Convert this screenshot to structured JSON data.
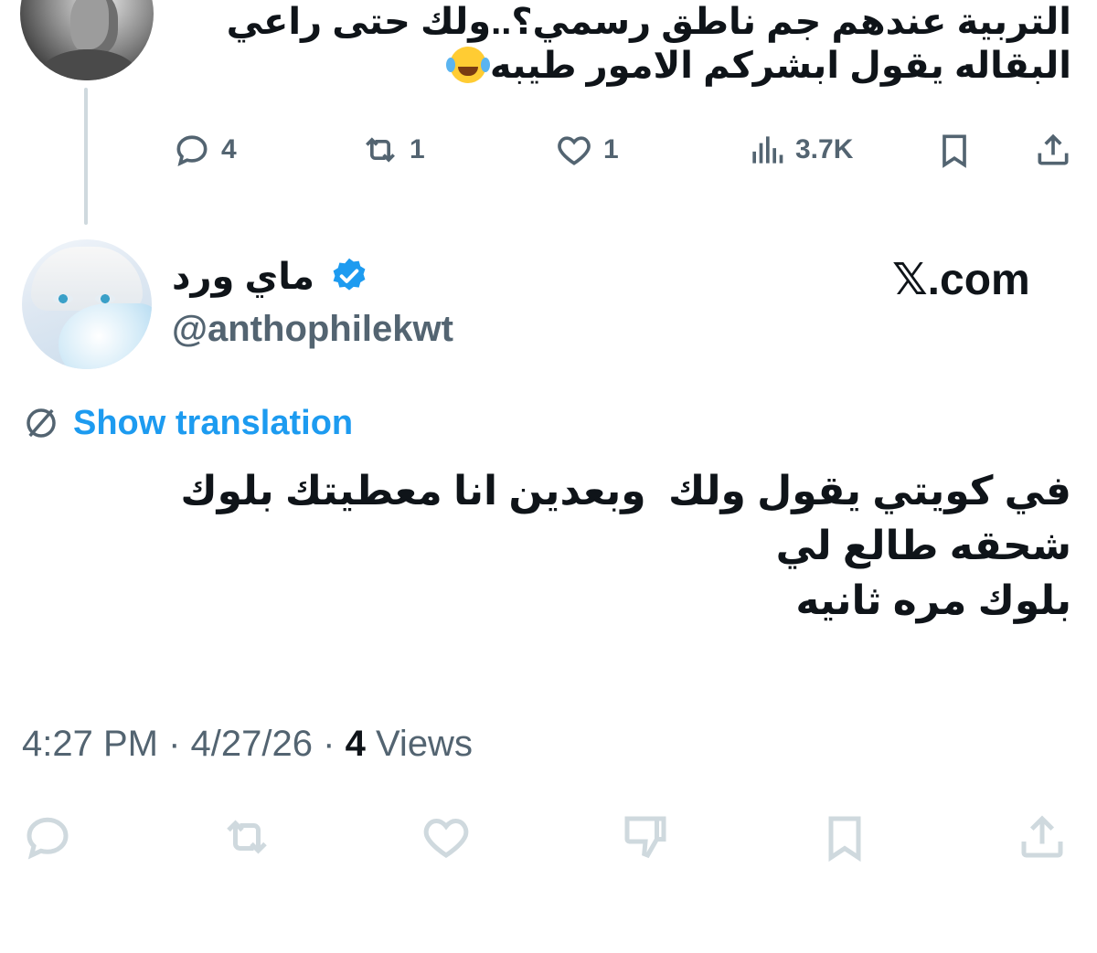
{
  "previous_tweet": {
    "text_lines": [
      "التربية عندهم جم ناطق رسمي؟..ولك حتى راعي",
      "البقاله يقول ابشركم الامور طيبه"
    ],
    "emoji": "face-with-tears-of-joy",
    "actions": {
      "replies": "4",
      "reposts": "1",
      "likes": "1",
      "views": "3.7K"
    }
  },
  "tweet": {
    "display_name": "ماي ورد",
    "handle": "@anthophilekwt",
    "verified": true,
    "source_label": "𝕏.com",
    "show_translation": "Show translation",
    "body_lines": [
      "في كويتي يقول ولك  وبعدين انا معطيتك بلوك",
      "شحقه طالع لي",
      "بلوك مره ثانيه"
    ],
    "time": "4:27 PM",
    "date": "4/27/26",
    "views_count": "4",
    "views_label": "Views",
    "separator": "·"
  },
  "colors": {
    "text": "#0f1419",
    "muted": "#536471",
    "link": "#1d9bf0",
    "disabled_icon": "#cfd9de"
  }
}
